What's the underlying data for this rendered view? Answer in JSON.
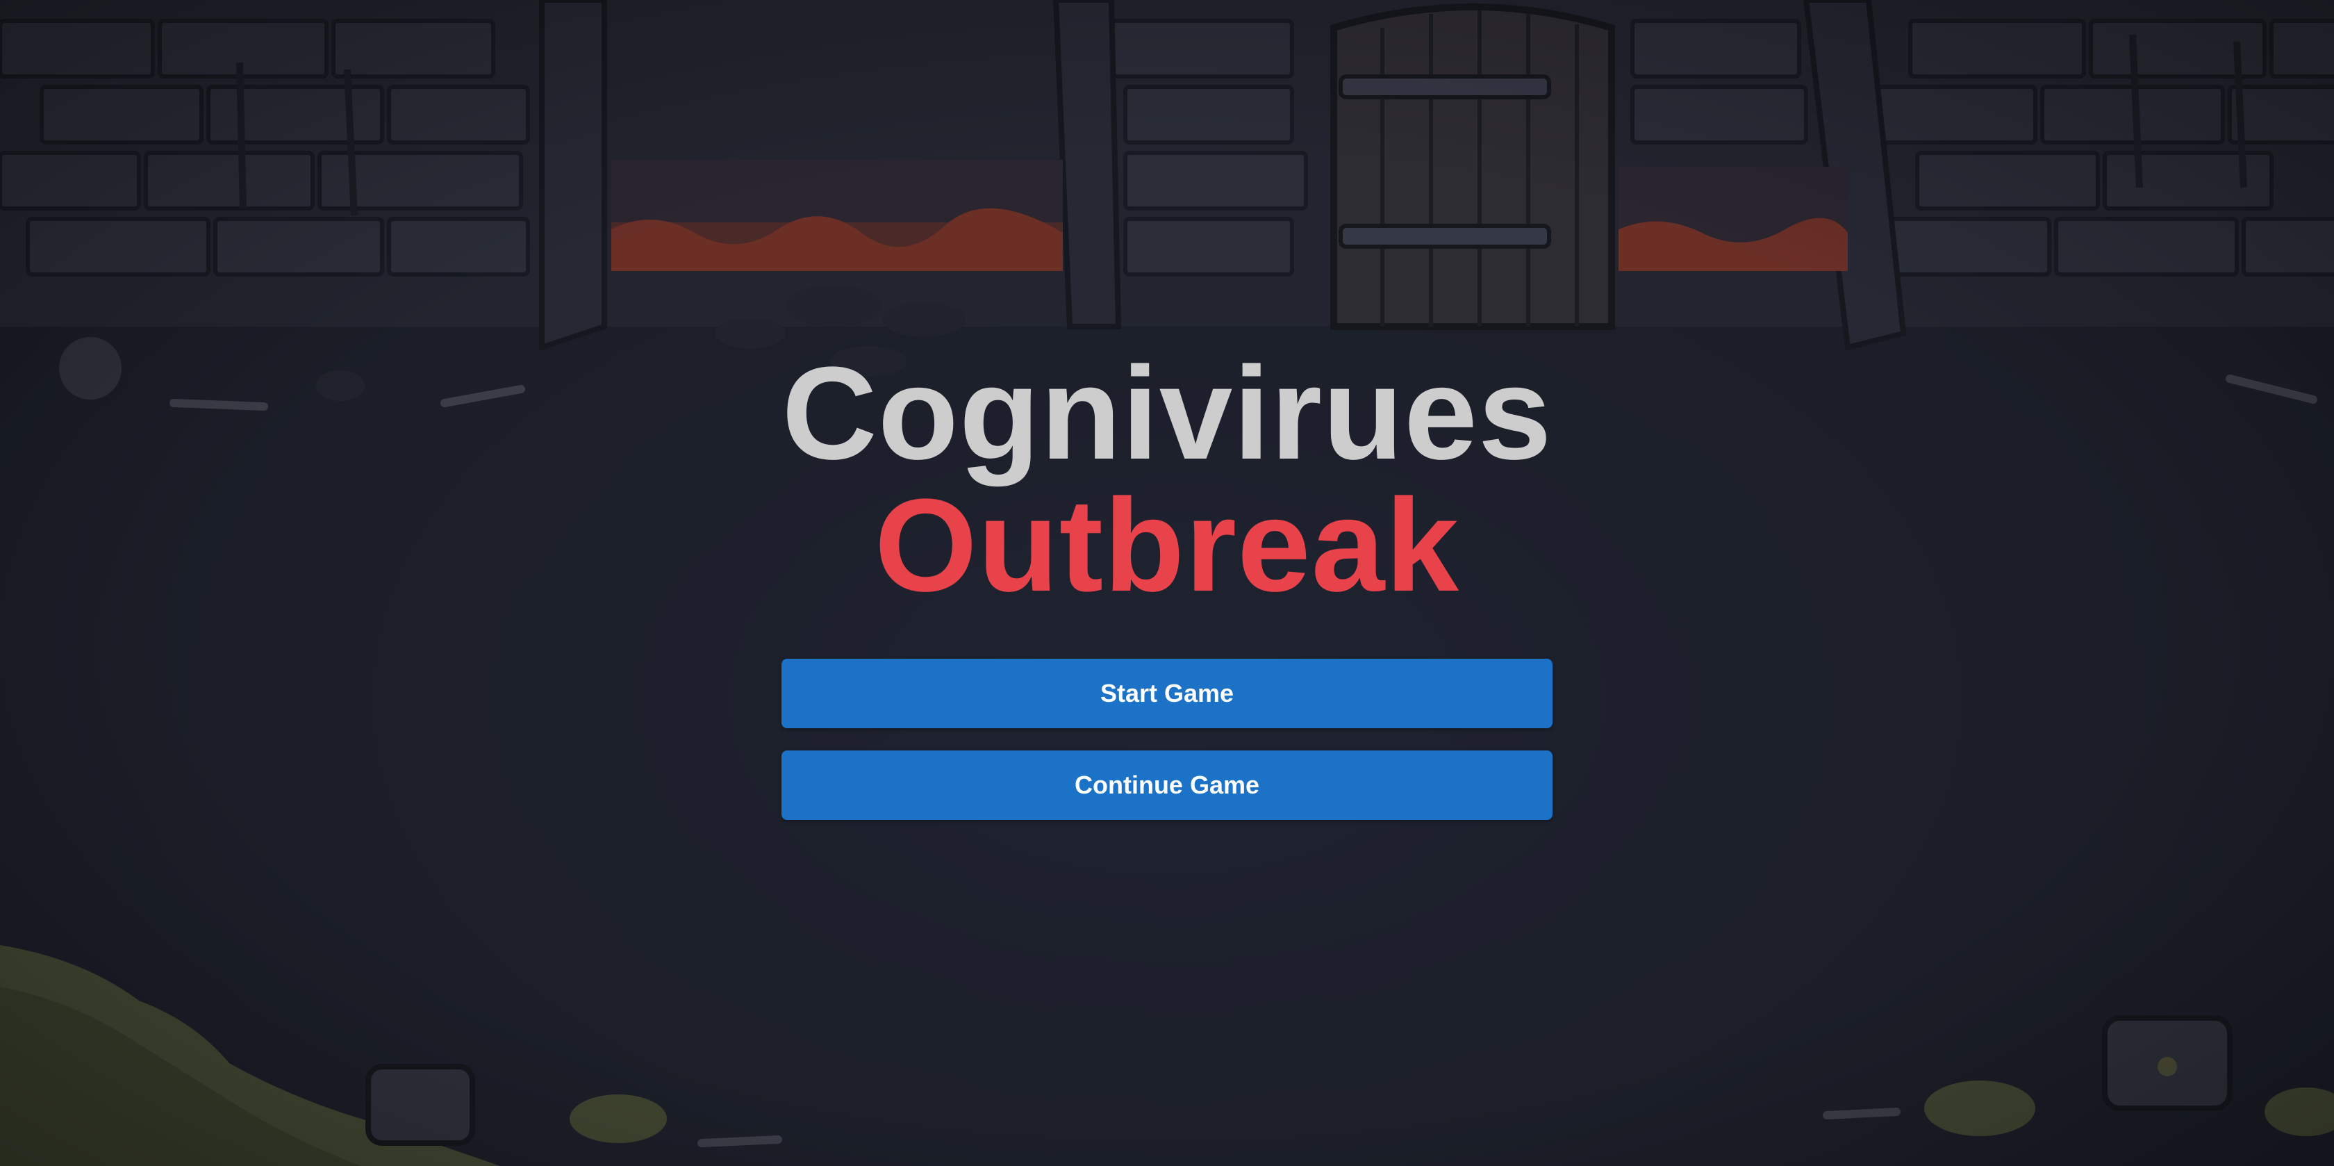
{
  "title": {
    "main": "Cognivirues",
    "sub": "Outbreak"
  },
  "menu": {
    "start_label": "Start Game",
    "continue_label": "Continue Game"
  },
  "colors": {
    "background": "#1b1e28",
    "title_main": "#cdcdcd",
    "title_sub": "#e8434a",
    "button": "#1b72c6",
    "button_text": "#ffffff"
  },
  "scene_elements": [
    "stone-wall",
    "wooden-door",
    "lava-pit",
    "chains",
    "bones",
    "treasure-chest",
    "moss-pile"
  ]
}
